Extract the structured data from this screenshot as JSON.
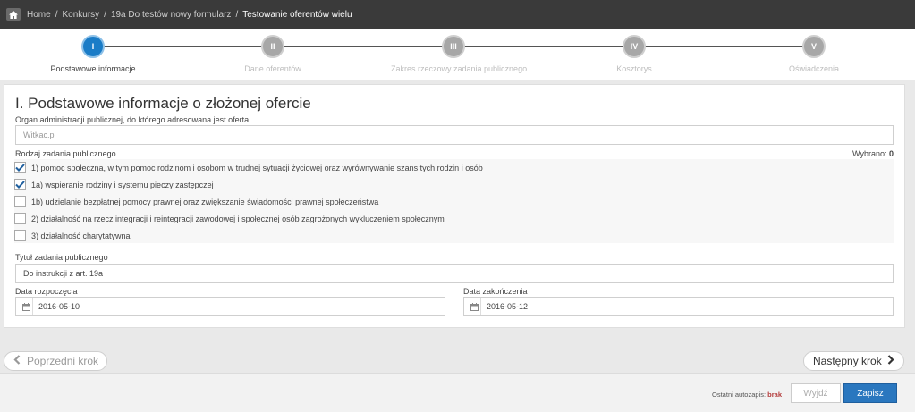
{
  "breadcrumb": {
    "items": [
      "Home",
      "Konkursy",
      "19a Do testów nowy formularz",
      "Testowanie oferentów wielu"
    ],
    "separator": "/"
  },
  "stepper": {
    "steps": [
      {
        "num": "I",
        "label": "Podstawowe informacje",
        "active": true
      },
      {
        "num": "II",
        "label": "Dane oferentów",
        "active": false
      },
      {
        "num": "III",
        "label": "Zakres rzeczowy zadania publicznego",
        "active": false
      },
      {
        "num": "IV",
        "label": "Kosztorys",
        "active": false
      },
      {
        "num": "V",
        "label": "Oświadczenia",
        "active": false
      }
    ]
  },
  "form": {
    "title": "I. Podstawowe informacje o złożonej ofercie",
    "organ_label": "Organ administracji publicznej, do którego adresowana jest oferta",
    "organ_value": "Witkac.pl",
    "rodzaj_label": "Rodzaj zadania publicznego",
    "wybrano_label": "Wybrano:",
    "wybrano_count": "0",
    "options": [
      {
        "label": "1) pomoc społeczna, w tym pomoc rodzinom i osobom w trudnej sytuacji życiowej oraz wyrównywanie szans tych rodzin i osób",
        "checked": true
      },
      {
        "label": "1a) wspieranie rodziny i systemu pieczy zastępczej",
        "checked": true
      },
      {
        "label": "1b) udzielanie bezpłatnej pomocy prawnej oraz zwiększanie świadomości prawnej społeczeństwa",
        "checked": false
      },
      {
        "label": "2) działalność na rzecz integracji i reintegracji zawodowej i społecznej osób zagrożonych wykluczeniem społecznym",
        "checked": false
      },
      {
        "label": "3) działalność charytatywna",
        "checked": false
      }
    ],
    "tytul_label": "Tytuł zadania publicznego",
    "tytul_value": "Do instrukcji z art. 19a",
    "start_label": "Data rozpoczęcia",
    "start_value": "2016-05-10",
    "end_label": "Data zakończenia",
    "end_value": "2016-05-12"
  },
  "nav": {
    "prev_label": "Poprzedni krok",
    "next_label": "Następny krok"
  },
  "footer": {
    "autosave_label": "Ostatni autozapis:",
    "autosave_value": "brak",
    "exit_label": "Wyjdź",
    "save_label": "Zapisz"
  },
  "colors": {
    "active_step": "#1a7cc7",
    "primary_button": "#2a77bf",
    "autosave_value": "#b33a3a"
  }
}
